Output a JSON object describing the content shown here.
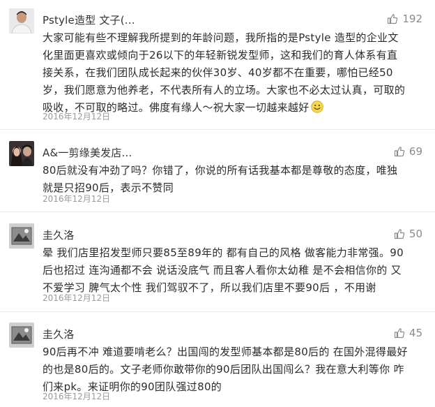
{
  "comments": [
    {
      "author": "Pstyle造型 文子(...",
      "likes": "192",
      "text": "大家可能有些不理解我所提到的年龄问题，我所指的是Pstyle 造型的企业文\n化里面更喜欢或倾向于26以下的年轻新锐发型师，这和我们的育人体系有直\n接关系，在我们团队成长起来的伙伴30岁、40岁都不在重要，哪怕已经50\n岁，我们愿意为他养老，不代表所有人的立场。大家也不必太过认真，可取的\n吸收，不可取的略过。佛度有缘人～祝大家一切越来越好",
      "date": "2016年12月12日"
    },
    {
      "author": "A&一剪缘美发店...",
      "likes": "69",
      "text": "80后就没有冲劲了吗？你错了，你说的所有话我基本都是尊敬的态度，唯独\n就是只招90后，表示不赞同",
      "date": "2016年12月12日"
    },
    {
      "author": "圭久洛",
      "likes": "50",
      "text": "晕 我们店里招发型师只要85至89年的 都有自己的风格  做客能力非常强。90\n后也招过 连沟通都不会 说话没底气 而且客人看你太幼稚 是不会相信你的 又\n不爱学习 脾气太个性 我们驾驭不了，所以我们店里不要90后 ，不用谢",
      "date": "2016年12月12日"
    },
    {
      "author": "圭久洛",
      "likes": "45",
      "text": "90后再不冲 难道要啃老么？出国闯的发型师基本都是80后的 在国外混得最好\n的也是80后的。文子老师你敢带你的90后团队出国闯么？我在意大利等你 咋\n们来pk。来证明你的90团队强过80的",
      "date": "2016年12月12日"
    }
  ]
}
